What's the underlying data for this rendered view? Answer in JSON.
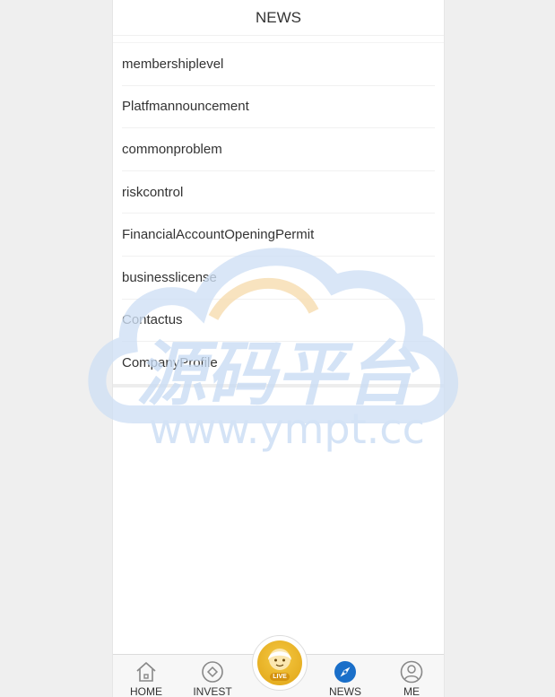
{
  "header": {
    "title": "NEWS"
  },
  "news_list": {
    "items": [
      "membershiplevel",
      "Platfmannouncement",
      "commonproblem",
      "riskcontrol",
      "FinancialAccountOpeningPermit",
      "businesslicense",
      "Contactus",
      "CompanyProfile"
    ]
  },
  "watermark": {
    "title": "源码平台",
    "url": "www.ympt.cc"
  },
  "tabbar": {
    "home_label": "HOME",
    "invest_label": "INVEST",
    "live_label": "LIVE",
    "news_label": "NEWS",
    "me_label": "ME",
    "active_color": "#1a6fc9",
    "live_color": "#e6ad1d"
  }
}
